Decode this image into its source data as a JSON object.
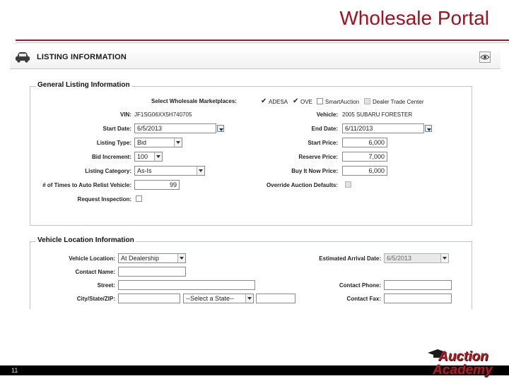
{
  "slide": {
    "title": "Wholesale Portal",
    "page_number": "11"
  },
  "listing": {
    "title": "LISTING INFORMATION"
  },
  "general": {
    "legend": "General Listing Information",
    "marketplaces": {
      "label": "Select Wholesale Marketplaces:",
      "options": [
        {
          "name": "ADESA",
          "checked": true
        },
        {
          "name": "OVE",
          "checked": true
        },
        {
          "name": "SmartAuction",
          "checked": false
        },
        {
          "name": "Dealer Trade Center",
          "checked": false,
          "disabled": true
        }
      ]
    },
    "vin": {
      "label": "VIN:",
      "value": "JF1SG06XX5H740705"
    },
    "vehicle": {
      "label": "Vehicle:",
      "value": "2005 SUBARU FORESTER"
    },
    "start_date": {
      "label": "Start Date:",
      "value": "6/5/2013"
    },
    "end_date": {
      "label": "End Date:",
      "value": "6/11/2013"
    },
    "listing_type": {
      "label": "Listing Type:",
      "value": "Bid"
    },
    "start_price": {
      "label": "Start Price:",
      "value": "6,000"
    },
    "bid_increment": {
      "label": "Bid Increment:",
      "value": "100"
    },
    "reserve_price": {
      "label": "Reserve Price:",
      "value": "7,000"
    },
    "listing_category": {
      "label": "Listing Category:",
      "value": "As-Is"
    },
    "buy_it_now": {
      "label": "Buy It Now Price:",
      "value": "6,000"
    },
    "auto_relist": {
      "label": "# of Times to Auto Relist Vehicle:",
      "value": "99"
    },
    "override": {
      "label": "Override Auction Defaults:"
    },
    "inspection": {
      "label": "Request Inspection:"
    }
  },
  "location": {
    "legend": "Vehicle Location Information",
    "vehicle_location": {
      "label": "Vehicle Location:",
      "value": "At Dealership"
    },
    "arrival_date": {
      "label": "Estimated Arrival Date:",
      "value": "6/5/2013"
    },
    "contact_name": {
      "label": "Contact Name:",
      "value": ""
    },
    "street": {
      "label": "Street:",
      "value": ""
    },
    "contact_phone": {
      "label": "Contact Phone:",
      "value": ""
    },
    "city_state_zip": {
      "label": "City/State/ZIP:",
      "state_value": "--Select a State--"
    },
    "contact_fax": {
      "label": "Contact Fax:",
      "value": ""
    }
  },
  "logo": {
    "line1": "Auction",
    "line2": "Academy"
  },
  "colors": {
    "title_red": "#a50f1d",
    "rule_red": "#9c1b24",
    "group_border": "#b9c6d6"
  }
}
